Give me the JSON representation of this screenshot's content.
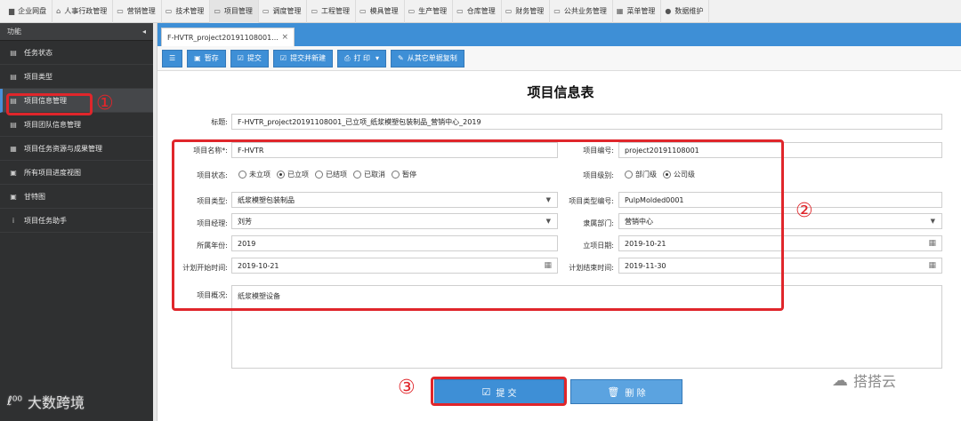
{
  "nav": [
    {
      "icon": "folder-icon",
      "glyph": "▆",
      "label": "企业网盘"
    },
    {
      "icon": "building-icon",
      "glyph": "⌂",
      "label": "人事行政管理"
    },
    {
      "icon": "folder-icon",
      "glyph": "▭",
      "label": "营销管理"
    },
    {
      "icon": "folder-icon",
      "glyph": "▭",
      "label": "技术管理"
    },
    {
      "icon": "folder-icon",
      "glyph": "▭",
      "label": "项目管理"
    },
    {
      "icon": "folder-icon",
      "glyph": "▭",
      "label": "调度管理"
    },
    {
      "icon": "folder-icon",
      "glyph": "▭",
      "label": "工程管理"
    },
    {
      "icon": "folder-icon",
      "glyph": "▭",
      "label": "模具管理"
    },
    {
      "icon": "folder-icon",
      "glyph": "▭",
      "label": "生产管理"
    },
    {
      "icon": "folder-icon",
      "glyph": "▭",
      "label": "仓库管理"
    },
    {
      "icon": "folder-icon",
      "glyph": "▭",
      "label": "财务管理"
    },
    {
      "icon": "folder-icon",
      "glyph": "▭",
      "label": "公共业务管理"
    },
    {
      "icon": "grid-icon",
      "glyph": "▦",
      "label": "菜单管理"
    },
    {
      "icon": "user-icon",
      "glyph": "●",
      "label": "数据维护"
    }
  ],
  "sidebar": {
    "header": "功能",
    "collapse_glyph": "◂",
    "items": [
      {
        "glyph": "▤",
        "label": "任务状态"
      },
      {
        "glyph": "▤",
        "label": "项目类型"
      },
      {
        "glyph": "▤",
        "label": "项目信息管理"
      },
      {
        "glyph": "▤",
        "label": "项目团队信息管理"
      },
      {
        "glyph": "▦",
        "label": "项目任务资源与成果管理"
      },
      {
        "glyph": "▣",
        "label": "所有项目进度视图"
      },
      {
        "glyph": "▣",
        "label": "甘特图"
      },
      {
        "glyph": "i",
        "label": "项目任务助手"
      }
    ]
  },
  "tab": {
    "label": "F-HVTR_project20191108001...",
    "close": "×"
  },
  "toolbar": {
    "list_glyph": "☰",
    "save": "暂存",
    "submit": "提交",
    "submit_new": "提交并新建",
    "print": "打 印",
    "print_caret": "▾",
    "copy_from": "从其它单据复制"
  },
  "form": {
    "title": "项目信息表",
    "subject_label": "标题:",
    "subject_value": "F-HVTR_project20191108001_已立项_纸浆模塑包装制品_营销中心_2019",
    "name_label": "项目名称*:",
    "name_value": "F-HVTR",
    "code_label": "项目编号:",
    "code_value": "project20191108001",
    "status_label": "项目状态:",
    "status_options": [
      "未立项",
      "已立项",
      "已结项",
      "已取消",
      "暂停"
    ],
    "level_label": "项目级别:",
    "level_options": [
      "部门级",
      "公司级"
    ],
    "type_label": "项目类型:",
    "type_value": "纸浆模塑包装制品",
    "type_code_label": "项目类型编号:",
    "type_code_value": "PulpMolded0001",
    "manager_label": "项目经理:",
    "manager_value": "刘芳",
    "dept_label": "隶属部门:",
    "dept_value": "营销中心",
    "year_label": "所属年份:",
    "year_value": "2019",
    "setup_date_label": "立项日期:",
    "setup_date_value": "2019-10-21",
    "plan_start_label": "计划开始时间:",
    "plan_start_value": "2019-10-21",
    "plan_end_label": "计划结束时间:",
    "plan_end_value": "2019-11-30",
    "overview_label": "项目概况:",
    "overview_value": "纸浆模塑设备"
  },
  "buttons": {
    "submit": "提 交",
    "delete": "删 除"
  },
  "annotations": {
    "one": "①",
    "two": "②",
    "three": "③"
  },
  "watermarks": {
    "left": "大数跨境",
    "left_logo": "ℓ⁰⁰",
    "right": "搭搭云",
    "right_logo": "☁"
  },
  "colors": {
    "accent": "#3e8fd6",
    "sidebar": "#2f3031",
    "annotation": "#e0262b"
  }
}
